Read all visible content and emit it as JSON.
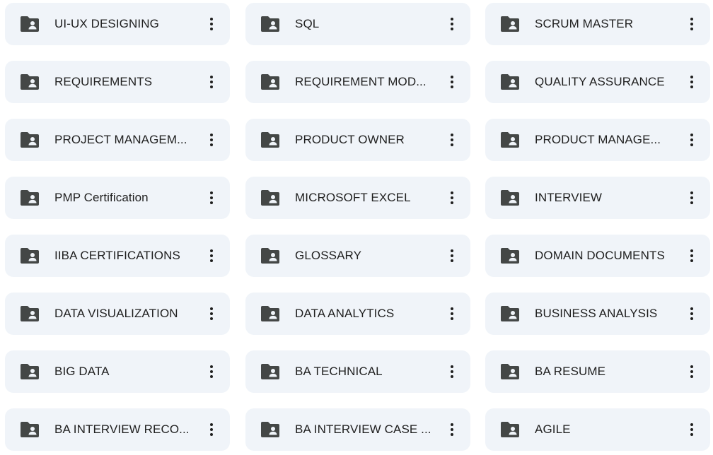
{
  "icons": {
    "folder": "shared-folder-icon",
    "more": "more-vert-icon"
  },
  "colors": {
    "card_background": "#f0f4f9",
    "icon": "#444746",
    "text": "#1f1f1f"
  },
  "folders": [
    {
      "name": "UI-UX DESIGNING"
    },
    {
      "name": "SQL"
    },
    {
      "name": "SCRUM MASTER"
    },
    {
      "name": "REQUIREMENTS"
    },
    {
      "name": "REQUIREMENT MOD..."
    },
    {
      "name": "QUALITY ASSURANCE"
    },
    {
      "name": "PROJECT MANAGEM..."
    },
    {
      "name": "PRODUCT OWNER"
    },
    {
      "name": "PRODUCT MANAGE..."
    },
    {
      "name": "PMP Certification"
    },
    {
      "name": "MICROSOFT EXCEL"
    },
    {
      "name": "INTERVIEW"
    },
    {
      "name": "IIBA CERTIFICATIONS"
    },
    {
      "name": "GLOSSARY"
    },
    {
      "name": "DOMAIN DOCUMENTS"
    },
    {
      "name": "DATA VISUALIZATION"
    },
    {
      "name": "DATA ANALYTICS"
    },
    {
      "name": "BUSINESS ANALYSIS"
    },
    {
      "name": "BIG DATA"
    },
    {
      "name": "BA TECHNICAL"
    },
    {
      "name": "BA RESUME"
    },
    {
      "name": "BA INTERVIEW RECO..."
    },
    {
      "name": "BA INTERVIEW CASE ..."
    },
    {
      "name": "AGILE"
    }
  ]
}
